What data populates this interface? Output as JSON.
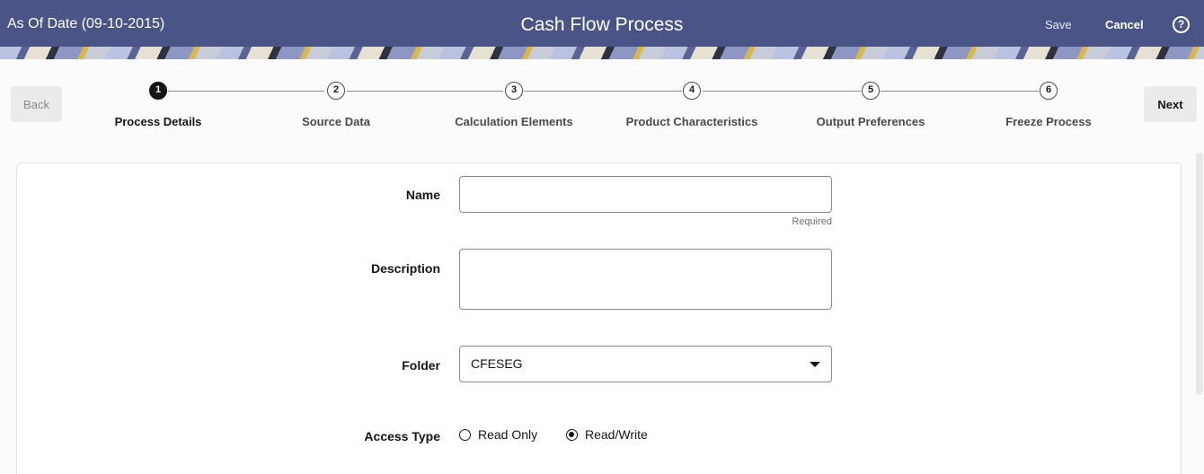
{
  "header": {
    "as_of_date": "As Of Date (09-10-2015)",
    "title": "Cash Flow Process",
    "save_label": "Save",
    "cancel_label": "Cancel",
    "help_icon": "?"
  },
  "train": {
    "back_label": "Back",
    "next_label": "Next",
    "active_step": 1,
    "steps": [
      {
        "number": "1",
        "label": "Process Details"
      },
      {
        "number": "2",
        "label": "Source Data"
      },
      {
        "number": "3",
        "label": "Calculation Elements"
      },
      {
        "number": "4",
        "label": "Product Characteristics"
      },
      {
        "number": "5",
        "label": "Output Preferences"
      },
      {
        "number": "6",
        "label": "Freeze Process"
      }
    ]
  },
  "form": {
    "name": {
      "label": "Name",
      "value": "",
      "helper": "Required"
    },
    "description": {
      "label": "Description",
      "value": ""
    },
    "folder": {
      "label": "Folder",
      "value": "CFESEG"
    },
    "access_type": {
      "label": "Access Type",
      "options": [
        "Read Only",
        "Read/Write"
      ],
      "selected": "Read/Write"
    }
  },
  "colors": {
    "header_bg": "#4a5487",
    "text": "#161513",
    "active_step": "#161513"
  }
}
